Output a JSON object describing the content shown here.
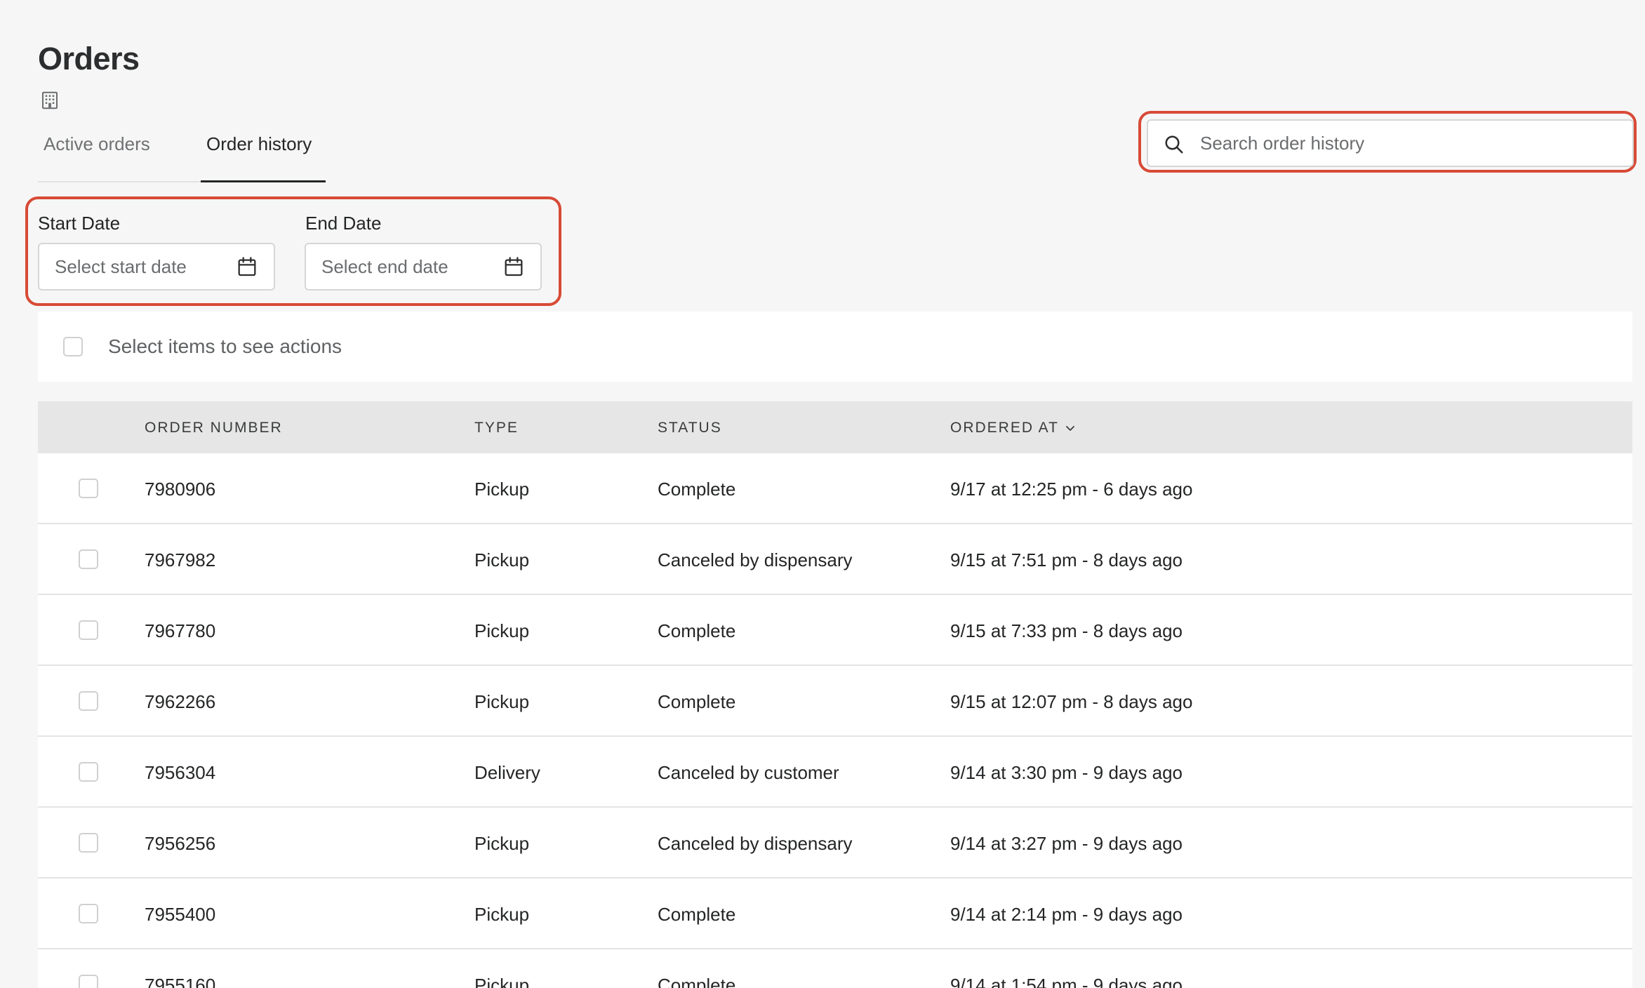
{
  "page": {
    "title": "Orders",
    "location_icon": "building-icon"
  },
  "tabs": [
    {
      "label": "Active orders",
      "active": false
    },
    {
      "label": "Order history",
      "active": true
    }
  ],
  "search": {
    "placeholder": "Search order history",
    "value": "",
    "icon": "search-icon"
  },
  "filters": {
    "start_date": {
      "label": "Start Date",
      "placeholder": "Select start date",
      "icon": "calendar-icon"
    },
    "end_date": {
      "label": "End Date",
      "placeholder": "Select end date",
      "icon": "calendar-icon"
    }
  },
  "actions_bar": {
    "text": "Select items to see actions",
    "select_all_checked": false
  },
  "table": {
    "columns": [
      "ORDER NUMBER",
      "TYPE",
      "STATUS",
      "ORDERED AT"
    ],
    "sort_column": "ORDERED AT",
    "sort_icon": "chevron-down-icon",
    "rows": [
      {
        "order_number": "7980906",
        "type": "Pickup",
        "status": "Complete",
        "ordered_at": "9/17 at 12:25 pm - 6 days ago"
      },
      {
        "order_number": "7967982",
        "type": "Pickup",
        "status": "Canceled by dispensary",
        "ordered_at": "9/15 at 7:51 pm - 8 days ago"
      },
      {
        "order_number": "7967780",
        "type": "Pickup",
        "status": "Complete",
        "ordered_at": "9/15 at 7:33 pm - 8 days ago"
      },
      {
        "order_number": "7962266",
        "type": "Pickup",
        "status": "Complete",
        "ordered_at": "9/15 at 12:07 pm - 8 days ago"
      },
      {
        "order_number": "7956304",
        "type": "Delivery",
        "status": "Canceled by customer",
        "ordered_at": "9/14 at 3:30 pm - 9 days ago"
      },
      {
        "order_number": "7956256",
        "type": "Pickup",
        "status": "Canceled by dispensary",
        "ordered_at": "9/14 at 3:27 pm - 9 days ago"
      },
      {
        "order_number": "7955400",
        "type": "Pickup",
        "status": "Complete",
        "ordered_at": "9/14 at 2:14 pm - 9 days ago"
      },
      {
        "order_number": "7955160",
        "type": "Pickup",
        "status": "Complete",
        "ordered_at": "9/14 at 1:54 pm - 9 days ago"
      }
    ]
  },
  "colors": {
    "highlight": "#d84a36",
    "background": "#f6f6f6",
    "header_bg": "#e6e6e6"
  }
}
